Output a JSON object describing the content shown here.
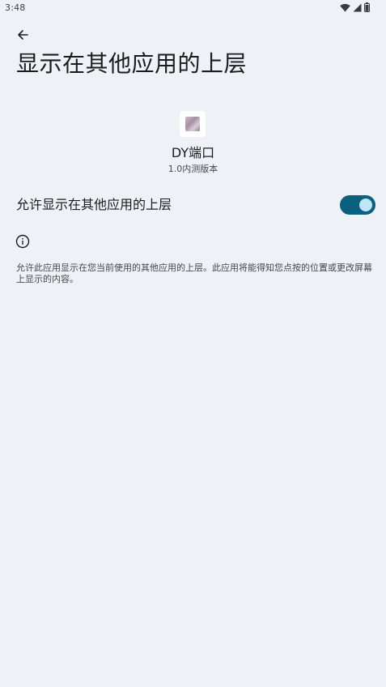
{
  "status_bar": {
    "time": "3:48",
    "icons": [
      "wifi-icon",
      "cellular-signal-icon",
      "battery-icon"
    ]
  },
  "header": {
    "back_icon": "arrow-back-icon",
    "title": "显示在其他应用的上层"
  },
  "app_info": {
    "icon": "app-icon",
    "name": "DY端口",
    "version": "1.0内测版本"
  },
  "permission": {
    "label": "允许显示在其他应用的上层",
    "enabled": true,
    "toggle_color": "#0b5f7f",
    "thumb_color": "#bfe6f7"
  },
  "info": {
    "icon": "info-icon",
    "description": "允许此应用显示在您当前使用的其他应用的上层。此应用将能得知您点按的位置或更改屏幕上显示的内容。"
  },
  "colors": {
    "background": "#eef1f6",
    "text_primary": "#1b1c1f",
    "text_secondary": "#45474c"
  }
}
